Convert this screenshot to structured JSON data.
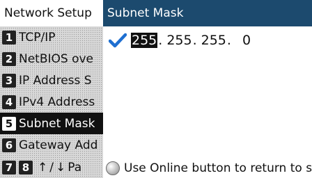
{
  "left_panel": {
    "title": "Network Setup",
    "items": [
      {
        "num": "1",
        "label": "TCP/IP"
      },
      {
        "num": "2",
        "label": "NetBIOS ove"
      },
      {
        "num": "3",
        "label": "IP Address S"
      },
      {
        "num": "4",
        "label": "IPv4 Address"
      },
      {
        "num": "5",
        "label": "Subnet Mask",
        "selected": true
      },
      {
        "num": "6",
        "label": "Gateway Add"
      }
    ],
    "nav": {
      "num7": "7",
      "num8": "8",
      "up": "↑",
      "slash": "/",
      "down": "↓",
      "label": "Pa"
    }
  },
  "right_panel": {
    "title": "Subnet Mask",
    "octets": [
      "255",
      "255",
      "255",
      "0"
    ],
    "separators": [
      ".",
      ".",
      "."
    ],
    "active_octet_index": 0,
    "footer_text": "Use Online button to return to s..."
  },
  "icons": {
    "check": "check-icon",
    "online": "online-button-icon"
  },
  "colors": {
    "title_bar": "#1c4a6e",
    "check": "#1e6fd1",
    "selected": "#111111"
  }
}
